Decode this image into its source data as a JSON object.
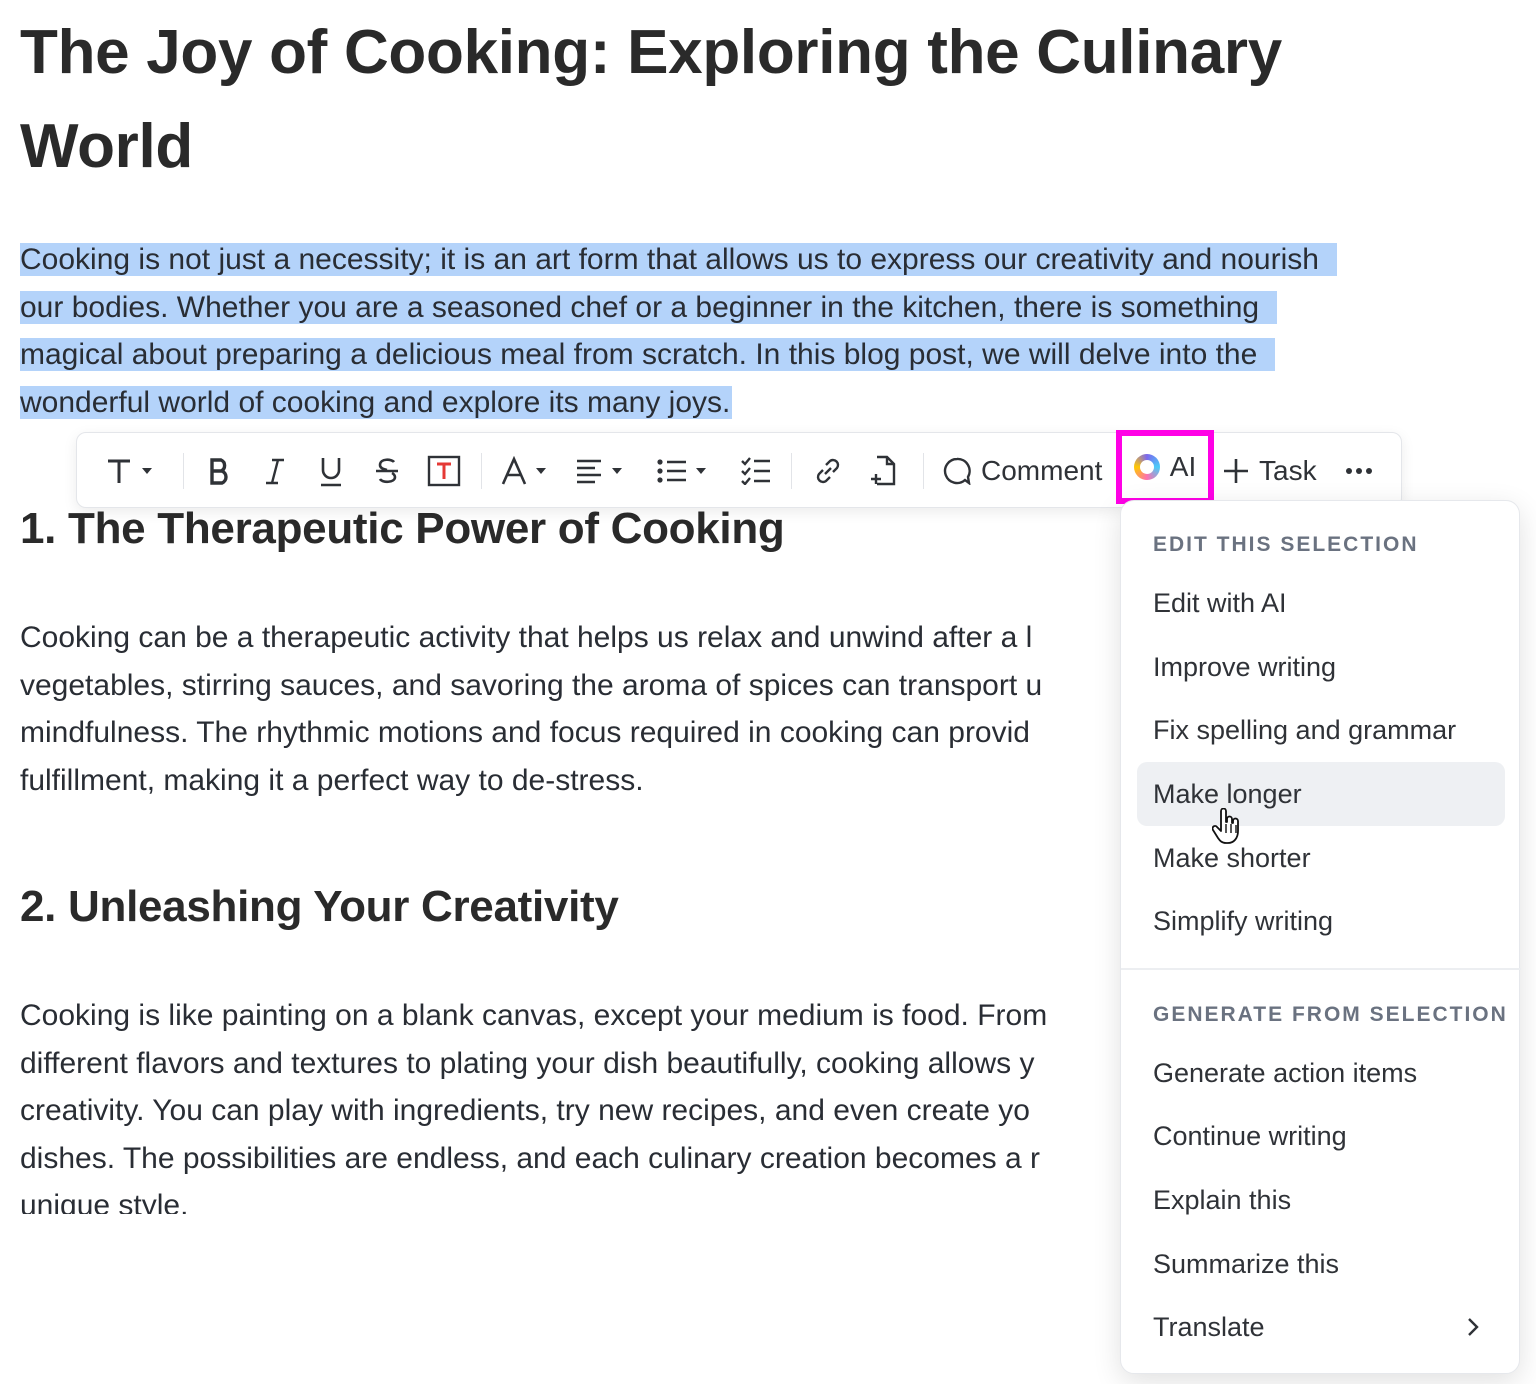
{
  "document": {
    "title": "The Joy of Cooking: Exploring the Culinary World",
    "title_lines": [
      "The Joy of Cooking: Exploring the Culinary",
      "World"
    ],
    "intro_lines": [
      "Cooking is not just a necessity; it is an art form that allows us to express our creativity and nourish",
      "our bodies. Whether you are a seasoned chef or a beginner in the kitchen, there is something",
      "magical about preparing a delicious meal from scratch. In this blog post, we will delve into the",
      "wonderful world of cooking and explore its many joys."
    ],
    "section1": {
      "heading": "1. The Therapeutic Power of Cooking",
      "lines": [
        "Cooking can be a therapeutic activity that helps us relax and unwind after a l",
        "vegetables, stirring sauces, and savoring the aroma of spices can transport u",
        "mindfulness. The rhythmic motions and focus required in cooking can provid",
        "fulfillment, making it a perfect way to de-stress."
      ]
    },
    "section2": {
      "heading": "2. Unleashing Your Creativity",
      "lines": [
        "Cooking is like painting on a blank canvas, except your medium is food. From",
        "different flavors and textures to plating your dish beautifully, cooking allows y",
        "creativity. You can play with ingredients, try new recipes, and even create yo",
        "dishes. The possibilities are endless, and each culinary creation becomes a r",
        "unique style."
      ]
    }
  },
  "toolbar": {
    "comment_label": "Comment",
    "ai_label": "AI",
    "task_label": "Task",
    "highlight_color": "#ff00e6"
  },
  "ai_menu": {
    "edit_section_label": "EDIT THIS SELECTION",
    "edit_items": [
      "Edit with AI",
      "Improve writing",
      "Fix spelling and grammar",
      "Make longer",
      "Make shorter",
      "Simplify writing"
    ],
    "hovered_item": "Make longer",
    "generate_section_label": "GENERATE FROM SELECTION",
    "generate_items": [
      "Generate action items",
      "Continue writing",
      "Explain this",
      "Summarize this",
      "Translate"
    ]
  },
  "colors": {
    "selection": "#b4d3fa",
    "text": "#292d34",
    "menu_hover": "#eef0f3"
  }
}
